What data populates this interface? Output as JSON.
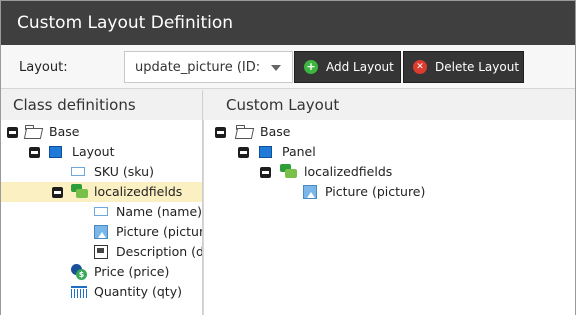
{
  "window": {
    "title": "Custom Layout Definition"
  },
  "toolbar": {
    "layout_label": "Layout:",
    "layout_select_value": "update_picture (ID:",
    "add_label": "Add Layout",
    "delete_label": "Delete Layout"
  },
  "left_panel": {
    "title": "Class definitions",
    "items": [
      {
        "label": "Base"
      },
      {
        "label": "Layout"
      },
      {
        "label": "SKU (sku)"
      },
      {
        "label": "localizedfields"
      },
      {
        "label": "Name (name)"
      },
      {
        "label": "Picture (picture"
      },
      {
        "label": "Description (de"
      },
      {
        "label": "Price (price)"
      },
      {
        "label": "Quantity (qty)"
      }
    ]
  },
  "right_panel": {
    "title": "Custom Layout",
    "items": [
      {
        "label": "Base"
      },
      {
        "label": "Panel"
      },
      {
        "label": "localizedfields"
      },
      {
        "label": "Picture (picture)"
      }
    ]
  },
  "colors": {
    "titlebar": "#3f3f3f",
    "button_bg": "#353535",
    "selection": "#fbf0c1",
    "add_icon": "#3eb53e",
    "delete_icon": "#dc3b2f"
  }
}
